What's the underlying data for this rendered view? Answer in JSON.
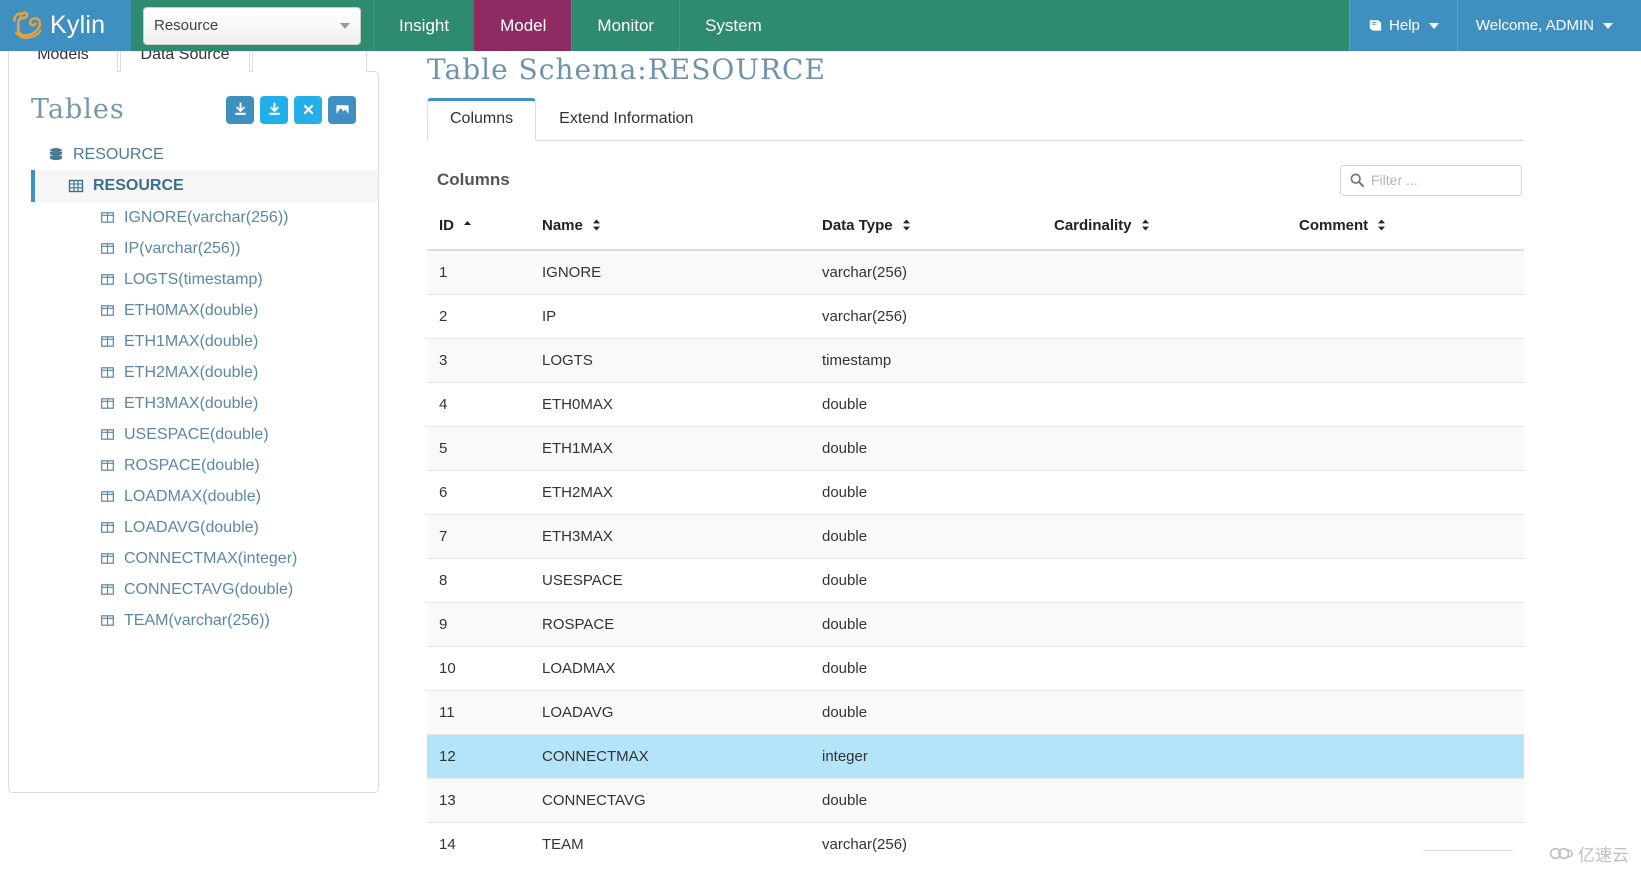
{
  "brand": {
    "name": "Kylin",
    "logo_icon": "kylin-logo-icon"
  },
  "project_select": {
    "value": "Resource",
    "caret_icon": "caret-down-icon"
  },
  "navbar": {
    "links": [
      {
        "label": "Insight",
        "active": false
      },
      {
        "label": "Model",
        "active": true
      },
      {
        "label": "Monitor",
        "active": false
      },
      {
        "label": "System",
        "active": false
      }
    ],
    "help": {
      "label": "Help",
      "icon": "book-icon",
      "caret_icon": "caret-down-icon"
    },
    "user": {
      "label": "Welcome, ADMIN",
      "caret_icon": "caret-down-icon"
    },
    "colors": {
      "bg": "#2e8b6f",
      "active_bg": "#8e2b63",
      "brand_bg": "#3f8fc0"
    }
  },
  "left_tabs": [
    {
      "label": "Models",
      "active": false
    },
    {
      "label": "Data Source",
      "active": true
    },
    {
      "label": "",
      "active": false
    }
  ],
  "left_panel": {
    "title": "Tables",
    "buttons": [
      {
        "name": "load-table-button",
        "icon": "download-icon",
        "color": "#3f8fc0"
      },
      {
        "name": "load-table-from-tree-button",
        "icon": "download-icon",
        "color": "#23b0e8"
      },
      {
        "name": "unload-table-button",
        "icon": "close-icon",
        "color": "#23b0e8"
      },
      {
        "name": "snapshot-button",
        "icon": "image-icon",
        "color": "#3f8fc0"
      }
    ],
    "tree": {
      "database": {
        "label": "RESOURCE",
        "icon": "database-icon"
      },
      "table": {
        "label": "RESOURCE",
        "icon": "table-icon",
        "selected": true
      },
      "columns": [
        "IGNORE(varchar(256))",
        "IP(varchar(256))",
        "LOGTS(timestamp)",
        "ETH0MAX(double)",
        "ETH1MAX(double)",
        "ETH2MAX(double)",
        "ETH3MAX(double)",
        "USESPACE(double)",
        "ROSPACE(double)",
        "LOADMAX(double)",
        "LOADAVG(double)",
        "CONNECTMAX(integer)",
        "CONNECTAVG(double)",
        "TEAM(varchar(256))"
      ]
    }
  },
  "main": {
    "schema_title": "Table Schema:RESOURCE",
    "tabs": [
      {
        "label": "Columns",
        "active": true
      },
      {
        "label": "Extend Information",
        "active": false
      }
    ],
    "section_title": "Columns",
    "filter": {
      "placeholder": "Filter ...",
      "value": "",
      "icon": "search-icon"
    },
    "table": {
      "headers": [
        {
          "label": "ID",
          "sort": "asc"
        },
        {
          "label": "Name",
          "sort": "none"
        },
        {
          "label": "Data Type",
          "sort": "none"
        },
        {
          "label": "Cardinality",
          "sort": "none"
        },
        {
          "label": "Comment",
          "sort": "none"
        }
      ],
      "rows": [
        {
          "id": "1",
          "name": "IGNORE",
          "type": "varchar(256)",
          "cardinality": "",
          "comment": "",
          "selected": false
        },
        {
          "id": "2",
          "name": "IP",
          "type": "varchar(256)",
          "cardinality": "",
          "comment": "",
          "selected": false
        },
        {
          "id": "3",
          "name": "LOGTS",
          "type": "timestamp",
          "cardinality": "",
          "comment": "",
          "selected": false
        },
        {
          "id": "4",
          "name": "ETH0MAX",
          "type": "double",
          "cardinality": "",
          "comment": "",
          "selected": false
        },
        {
          "id": "5",
          "name": "ETH1MAX",
          "type": "double",
          "cardinality": "",
          "comment": "",
          "selected": false
        },
        {
          "id": "6",
          "name": "ETH2MAX",
          "type": "double",
          "cardinality": "",
          "comment": "",
          "selected": false
        },
        {
          "id": "7",
          "name": "ETH3MAX",
          "type": "double",
          "cardinality": "",
          "comment": "",
          "selected": false
        },
        {
          "id": "8",
          "name": "USESPACE",
          "type": "double",
          "cardinality": "",
          "comment": "",
          "selected": false
        },
        {
          "id": "9",
          "name": "ROSPACE",
          "type": "double",
          "cardinality": "",
          "comment": "",
          "selected": false
        },
        {
          "id": "10",
          "name": "LOADMAX",
          "type": "double",
          "cardinality": "",
          "comment": "",
          "selected": false
        },
        {
          "id": "11",
          "name": "LOADAVG",
          "type": "double",
          "cardinality": "",
          "comment": "",
          "selected": false
        },
        {
          "id": "12",
          "name": "CONNECTMAX",
          "type": "integer",
          "cardinality": "",
          "comment": "",
          "selected": true
        },
        {
          "id": "13",
          "name": "CONNECTAVG",
          "type": "double",
          "cardinality": "",
          "comment": "",
          "selected": false
        },
        {
          "id": "14",
          "name": "TEAM",
          "type": "varchar(256)",
          "cardinality": "",
          "comment": "",
          "selected": false
        }
      ]
    }
  },
  "watermark": {
    "text": "亿速云",
    "icon": "cloud-icon"
  }
}
